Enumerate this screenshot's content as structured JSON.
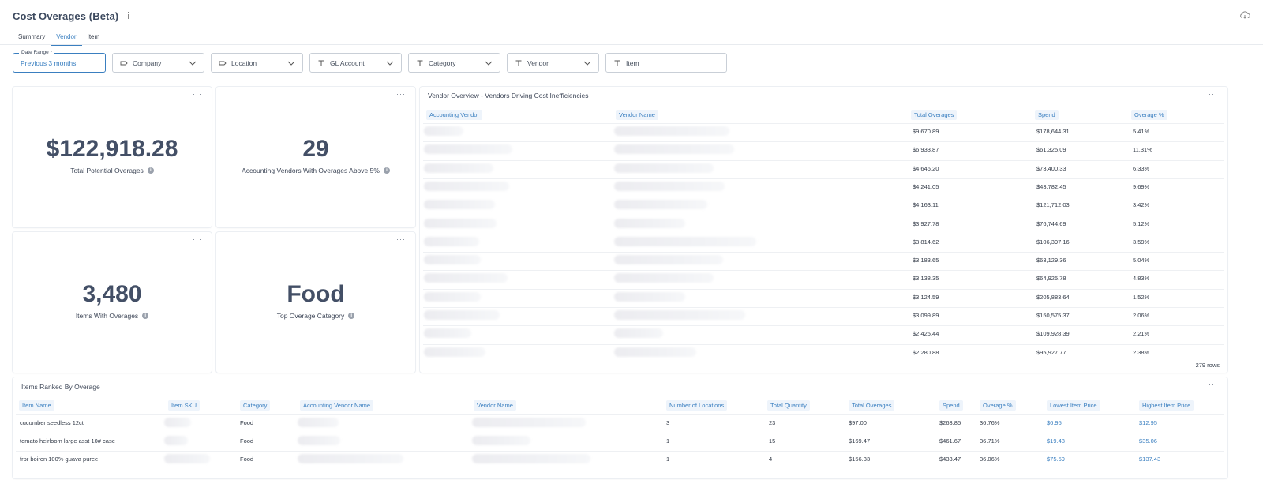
{
  "header": {
    "title": "Cost Overages (Beta)"
  },
  "tabs": [
    "Summary",
    "Vendor",
    "Item"
  ],
  "filters": {
    "date_range_label": "Date Range *",
    "date_range_value": "Previous 3 months",
    "company": "Company",
    "location": "Location",
    "gl_account": "GL Account",
    "category": "Category",
    "vendor": "Vendor",
    "item": "Item"
  },
  "kpis": {
    "total_overages": {
      "value": "$122,918.28",
      "label": "Total Potential Overages"
    },
    "vendors_above": {
      "value": "29",
      "label": "Accounting Vendors With Overages Above 5%"
    },
    "items_with_overages": {
      "value": "3,480",
      "label": "Items With Overages"
    },
    "top_category": {
      "value": "Food",
      "label": "Top Overage Category"
    }
  },
  "vendor_overview": {
    "title": "Vendor Overview - Vendors Driving Cost Inefficiencies",
    "columns": [
      "Accounting Vendor",
      "Vendor Name",
      "Total Overages",
      "Spend",
      "Overage %"
    ],
    "rows": [
      [
        "$9,670.89",
        "$178,644.31",
        "5.41%"
      ],
      [
        "$6,933.87",
        "$61,325.09",
        "11.31%"
      ],
      [
        "$4,646.20",
        "$73,400.33",
        "6.33%"
      ],
      [
        "$4,241.05",
        "$43,782.45",
        "9.69%"
      ],
      [
        "$4,163.11",
        "$121,712.03",
        "3.42%"
      ],
      [
        "$3,927.78",
        "$76,744.69",
        "5.12%"
      ],
      [
        "$3,814.62",
        "$106,397.16",
        "3.59%"
      ],
      [
        "$3,183.65",
        "$63,129.36",
        "5.04%"
      ],
      [
        "$3,138.35",
        "$64,925.78",
        "4.83%"
      ],
      [
        "$3,124.59",
        "$205,883.64",
        "1.52%"
      ],
      [
        "$3,099.89",
        "$150,575.37",
        "2.06%"
      ],
      [
        "$2,425.44",
        "$109,928.39",
        "2.21%"
      ],
      [
        "$2,280.88",
        "$95,927.77",
        "2.38%"
      ]
    ],
    "row_count": "279 rows"
  },
  "items_ranked": {
    "title": "Items Ranked By Overage",
    "columns": [
      "Item Name",
      "Item SKU",
      "Category",
      "Accounting Vendor Name",
      "Vendor Name",
      "Number of Locations",
      "Total Quantity",
      "Total Overages",
      "Spend",
      "Overage %",
      "Lowest Item Price",
      "Highest Item Price"
    ],
    "rows": [
      [
        "cucumber seedless 12ct",
        "Food",
        "3",
        "23",
        "$97.00",
        "$263.85",
        "36.76%",
        "$6.95",
        "$12.95"
      ],
      [
        "tomato heirloom large asst 10# case",
        "Food",
        "1",
        "15",
        "$169.47",
        "$461.67",
        "36.71%",
        "$19.48",
        "$35.06"
      ],
      [
        "frpr boiron 100% guava puree",
        "Food",
        "1",
        "4",
        "$156.33",
        "$433.47",
        "36.06%",
        "$75.59",
        "$137.43"
      ]
    ]
  }
}
